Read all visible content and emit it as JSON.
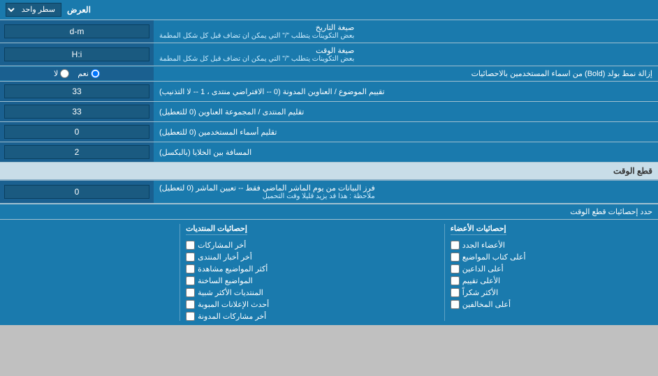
{
  "title": "العرض",
  "rows": [
    {
      "id": "single-line",
      "label": "سطر واحد",
      "isHeader": true,
      "hasSelect": true,
      "selectValue": "سطر واحد"
    },
    {
      "id": "date-format",
      "label": "صيغة التاريخ",
      "sublabel": "بعض التكوينات يتطلب \"/\" التي يمكن ان تضاف قبل كل شكل المطمة",
      "value": "d-m"
    },
    {
      "id": "time-format",
      "label": "صيغة الوقت",
      "sublabel": "بعض التكوينات يتطلب \"/\" التي يمكن ان تضاف قبل كل شكل المطمة",
      "value": "H:i"
    },
    {
      "id": "bold-remove",
      "label": "إزالة نمط بولد (Bold) من اسماء المستخدمين بالاحصائيات",
      "isRadio": true,
      "radioOptions": [
        "نعم",
        "لا"
      ],
      "radioSelected": "نعم"
    },
    {
      "id": "topic-count",
      "label": "تقييم الموضوع / العناوين المدونة (0 -- الافتراضي منتدى ، 1 -- لا التذنيب)",
      "value": "33"
    },
    {
      "id": "forum-group",
      "label": "تقليم المنتدى / المجموعة العناوين (0 للتعطيل)",
      "value": "33"
    },
    {
      "id": "username-trim",
      "label": "تقليم أسماء المستخدمين (0 للتعطيل)",
      "value": "0"
    },
    {
      "id": "column-gap",
      "label": "المسافة بين الخلايا (بالبكسل)",
      "value": "2"
    }
  ],
  "cutoffSection": {
    "header": "قطع الوقت",
    "rows": [
      {
        "id": "cutoff-days",
        "label": "فرز البيانات من يوم الماشر الماضي فقط -- تعيين الماشر (0 لتعطيل)",
        "sublabel": "ملاحظة : هذا قد يزيد قليلا وقت التحميل",
        "value": "0"
      }
    ],
    "statsHeader": "حدد إحصائيات قطع الوقت",
    "checkboxGroups": [
      {
        "id": "member-stats",
        "header": "إحصائيات الأعضاء",
        "items": [
          "الأعضاء الجدد",
          "أعلى كتاب المواضيع",
          "أعلى الداعين",
          "الأعلى تقييم",
          "الأكثر شكراً",
          "أعلى المخالفين"
        ]
      },
      {
        "id": "post-stats",
        "header": "إحصائيات المنتديات",
        "items": [
          "أخر المشاركات",
          "أخر أخبار المنتدى",
          "أكثر المواضيع مشاهدة",
          "المواضيع الساخنة",
          "المنتديات الأكثر شبية",
          "أحدث الإعلانات المبوبة",
          "أخر مشاركات المدونة"
        ]
      }
    ]
  }
}
